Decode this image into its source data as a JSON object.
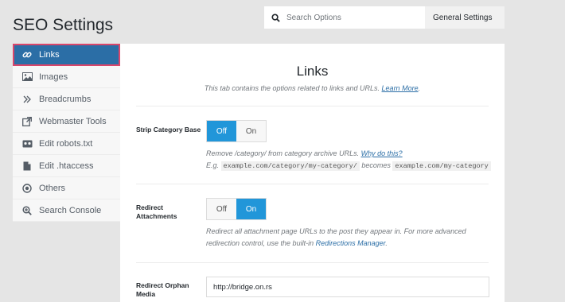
{
  "page_title": "SEO Settings",
  "search": {
    "placeholder": "Search Options"
  },
  "general_settings_label": "General Settings",
  "sidebar": {
    "items": [
      {
        "label": "Links",
        "icon": "link-icon",
        "active": true
      },
      {
        "label": "Images",
        "icon": "image-icon"
      },
      {
        "label": "Breadcrumbs",
        "icon": "chevrons-right-icon"
      },
      {
        "label": "Webmaster Tools",
        "icon": "external-link-icon"
      },
      {
        "label": "Edit robots.txt",
        "icon": "robot-icon"
      },
      {
        "label": "Edit .htaccess",
        "icon": "file-icon"
      },
      {
        "label": "Others",
        "icon": "dot-circle-icon"
      },
      {
        "label": "Search Console",
        "icon": "search-plus-icon"
      }
    ]
  },
  "main": {
    "title": "Links",
    "subtitle": "This tab contains the options related to links and URLs.",
    "learn_more": "Learn More",
    "subtitle_end": "."
  },
  "strip_category": {
    "label": "Strip Category Base",
    "off": "Off",
    "on": "On",
    "selected": "Off",
    "desc_text": "Remove /category/ from category archive URLs.",
    "desc_link": "Why do this?",
    "eg": "E.g.",
    "code1": "example.com/category/my-category/",
    "becomes": "becomes",
    "code2": "example.com/my-category"
  },
  "redirect_attachments": {
    "label": "Redirect Attachments",
    "off": "Off",
    "on": "On",
    "selected": "On",
    "desc_line1": "Redirect all attachment page URLs to the post they appear in. For more advanced",
    "desc_line2": "redirection control, use the built-in",
    "desc_link": "Redirections Manager",
    "desc_end": "."
  },
  "redirect_orphan": {
    "label": "Redirect Orphan Media",
    "value": "http://bridge.on.rs"
  },
  "colors": {
    "active_sidebar": "#2b6ea6",
    "active_outline": "#d9466b",
    "toggle_on": "#2196d9"
  }
}
